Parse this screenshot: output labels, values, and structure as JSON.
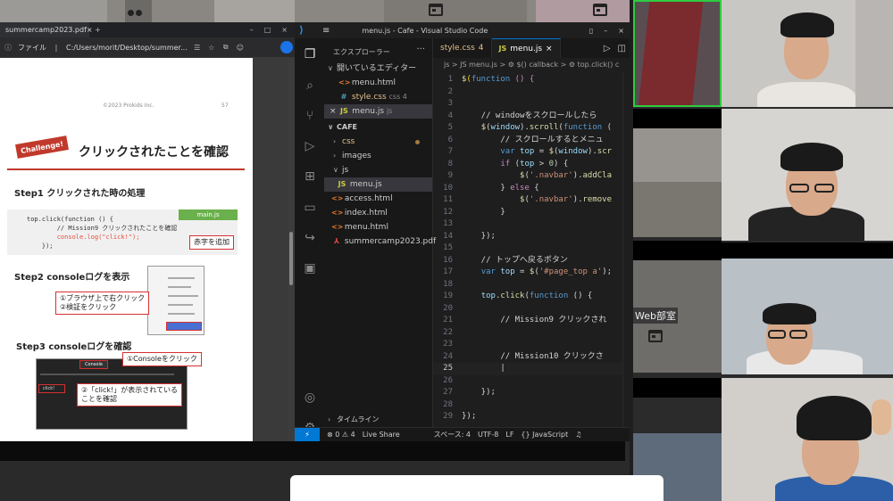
{
  "pdf_viewer": {
    "tab_title": "summercamp2023.pdf",
    "address_label": "ファイル",
    "address_path": "C:/Users/morit/Desktop/summer...",
    "page1": {
      "copyright": "©2023 Prokids Inc.",
      "page_number": "57"
    },
    "challenge_badge": "Challenge!",
    "heading": "クリックされたことを確認",
    "step1": "Step1 クリックされた時の処理",
    "code_filename": "main.js",
    "code_lines": [
      "top.click(function () {",
      "        // Mission9 クリックされたことを確認",
      "        console.log(\"click!\");",
      "    });"
    ],
    "note_red_text": "赤字を追加",
    "step2": "Step2 consoleログを表示",
    "step2_note_line1": "①ブラウザ上で右クリック",
    "step2_note_line2": "②検証をクリック",
    "step3": "Step3 consoleログを確認",
    "step3_note1": "①Consoleをクリック",
    "step3_note2_line1": "②「click!」が表示されている",
    "step3_note2_line2": "ことを確認",
    "console_tab_label": "Console",
    "click_output": "click!"
  },
  "vscode": {
    "window_title": "menu.js - Cafe - Visual Studio Code",
    "explorer_title": "エクスプローラー",
    "open_editors_label": "開いているエディター",
    "open_editors": [
      {
        "icon": "html",
        "name": "menu.html",
        "close": "",
        "badge": ""
      },
      {
        "icon": "css",
        "name": "style.css",
        "close": "",
        "badge": "css  4"
      },
      {
        "icon": "js",
        "name": "menu.js",
        "close": "×",
        "badge": "js"
      }
    ],
    "folder_label": "CAFE",
    "tree": [
      {
        "type": "folder",
        "name": "css"
      },
      {
        "type": "folder",
        "name": "images"
      },
      {
        "type": "folder-open",
        "name": "js"
      },
      {
        "type": "js",
        "name": "menu.js"
      },
      {
        "type": "html",
        "name": "access.html"
      },
      {
        "type": "html",
        "name": "index.html"
      },
      {
        "type": "html",
        "name": "menu.html"
      },
      {
        "type": "pdf",
        "name": "summercamp2023.pdf"
      }
    ],
    "timeline_label": "タイムライン",
    "tabs": [
      {
        "name": "style.css",
        "badge": "4"
      },
      {
        "name": "menu.js",
        "badge": "×"
      }
    ],
    "breadcrumb": "js > JS menu.js > ⚙ $() callback > ⚙ top.click() c",
    "status": {
      "remote": "⚡",
      "problems": "⊗ 0 ⚠ 4",
      "live_share": "Live Share",
      "spaces": "スペース: 4",
      "encoding": "UTF-8",
      "eol": "LF",
      "language": "{} JavaScript"
    },
    "code_lines": [
      {
        "n": "1",
        "text": "$(function () {"
      },
      {
        "n": "2",
        "text": ""
      },
      {
        "n": "3",
        "text": ""
      },
      {
        "n": "4",
        "text": "    // windowをスクロールしたら"
      },
      {
        "n": "5",
        "text": "    $(window).scroll(function ("
      },
      {
        "n": "6",
        "text": "        // スクロールするとメニュ"
      },
      {
        "n": "7",
        "text": "        var top = $(window).scr"
      },
      {
        "n": "8",
        "text": "        if (top > 0) {"
      },
      {
        "n": "9",
        "text": "            $('.navbar').addCla"
      },
      {
        "n": "10",
        "text": "        } else {"
      },
      {
        "n": "11",
        "text": "            $('.navbar').remove"
      },
      {
        "n": "12",
        "text": "        }"
      },
      {
        "n": "13",
        "text": ""
      },
      {
        "n": "14",
        "text": "    });"
      },
      {
        "n": "15",
        "text": ""
      },
      {
        "n": "16",
        "text": "    // トップへ戻るボタン"
      },
      {
        "n": "17",
        "text": "    var top = $('#page_top a');"
      },
      {
        "n": "18",
        "text": ""
      },
      {
        "n": "19",
        "text": "    top.click(function () {"
      },
      {
        "n": "20",
        "text": ""
      },
      {
        "n": "21",
        "text": "        // Mission9 クリックされ"
      },
      {
        "n": "22",
        "text": ""
      },
      {
        "n": "23",
        "text": ""
      },
      {
        "n": "24",
        "text": "        // Mission10 クリックさ"
      },
      {
        "n": "25",
        "text": "        |"
      },
      {
        "n": "26",
        "text": ""
      },
      {
        "n": "27",
        "text": "    });"
      },
      {
        "n": "28",
        "text": ""
      },
      {
        "n": "29",
        "text": "});"
      }
    ]
  },
  "meeting": {
    "room_label": "Web部室"
  }
}
